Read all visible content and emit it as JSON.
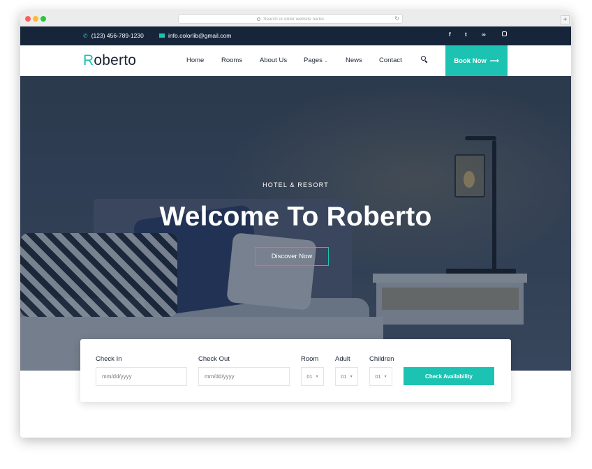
{
  "browser": {
    "url_placeholder": "Search or enter website name",
    "new_tab": "+"
  },
  "topbar": {
    "phone": "(123) 456-789-1230",
    "email": "info.colorlib@gmail.com",
    "social_icons": [
      "facebook-icon",
      "twitter-icon",
      "tripadvisor-icon",
      "instagram-icon"
    ],
    "social": {
      "facebook": "f",
      "twitter": "t"
    }
  },
  "nav": {
    "logo_letter": "R",
    "logo_rest": "oberto",
    "items": [
      "Home",
      "Rooms",
      "About Us",
      "Pages",
      "News",
      "Contact"
    ],
    "cta": "Book Now",
    "cta_arrow": "⟶"
  },
  "hero": {
    "kicker": "HOTEL & RESORT",
    "title": "Welcome To Roberto",
    "button": "Discover Now"
  },
  "booking": {
    "check_in_label": "Check In",
    "check_in_value": "mm/dd/yyyy",
    "check_out_label": "Check Out",
    "check_out_value": "mm/dd/yyyy",
    "room_label": "Room",
    "room_value": "01",
    "adult_label": "Adult",
    "adult_value": "01",
    "children_label": "Children",
    "children_value": "01",
    "button": "Check Availability"
  },
  "colors": {
    "accent": "#1cc3b2",
    "topbar": "#16253a",
    "text_dark": "#1b2436"
  }
}
